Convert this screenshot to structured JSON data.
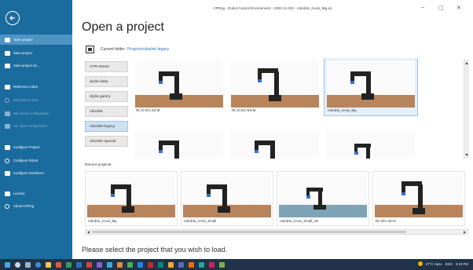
{
  "window": {
    "title": "CPRog - Robot Control Environment - V902-11-020 - robolink_4Axis_Big.prj",
    "minimize": "–",
    "maximize": "▢",
    "close": "✕"
  },
  "sidebar": {
    "items": [
      {
        "label": "Open project",
        "icon": "folder-open-icon",
        "active": true,
        "dim": false
      },
      {
        "label": "Save project",
        "icon": "save-icon",
        "active": false,
        "dim": false
      },
      {
        "label": "Save project as...",
        "icon": "save-as-icon",
        "active": false,
        "dim": false
      },
      {
        "label": "Reference robot",
        "icon": "reference-icon",
        "active": false,
        "dim": false
      },
      {
        "label": "Set joints to zero",
        "icon": "zero-icon",
        "active": false,
        "dim": true
      },
      {
        "label": "Set Jjoints configuration",
        "icon": "joints-config-icon",
        "active": false,
        "dim": true
      },
      {
        "label": "Set Jjoint configuration",
        "icon": "joint-config-icon",
        "active": false,
        "dim": true
      },
      {
        "label": "Configure Project",
        "icon": "configure-project-icon",
        "active": false,
        "dim": false
      },
      {
        "label": "Configure Robot",
        "icon": "configure-robot-icon",
        "active": false,
        "dim": false
      },
      {
        "label": "Configure Interfaces",
        "icon": "configure-interfaces-icon",
        "active": false,
        "dim": false
      },
      {
        "label": "License",
        "icon": "license-icon",
        "active": false,
        "dim": false
      },
      {
        "label": "About CPRog",
        "icon": "info-icon",
        "active": false,
        "dim": false
      }
    ]
  },
  "main": {
    "title": "Open a project",
    "current_folder_label": "Current folder:",
    "current_folder_path": "Projects\\robolink-legacy",
    "categories": [
      "CPR-Mover",
      "drylin-delta",
      "drylin-gantry",
      "robolink",
      "robolink-legacy",
      "robolink-special"
    ],
    "selected_category": "robolink-legacy",
    "projects": [
      "RL-D-DCi-4S-M",
      "RL-D-DCi-5S-M",
      "robolink_4Axis_Big",
      "",
      "",
      ""
    ],
    "selected_project": "robolink_4Axis_Big",
    "recent_label": "Recent projects:",
    "recent": [
      "robolink_4Axis_Big",
      "robolink_4Axis_Small",
      "robolink_4Axis_Small_AE",
      "RL-DCi-4S-M"
    ],
    "hint": "Please select the project that you wish to load."
  },
  "taskbar": {
    "weather": "27°C Haze",
    "lang": "ENG",
    "time": "9:23 PM"
  },
  "colors": {
    "sidebar": "#1b6c9e",
    "active_item": "#4d94c4",
    "link": "#2b73b8",
    "taskbar": "#1f3247"
  }
}
